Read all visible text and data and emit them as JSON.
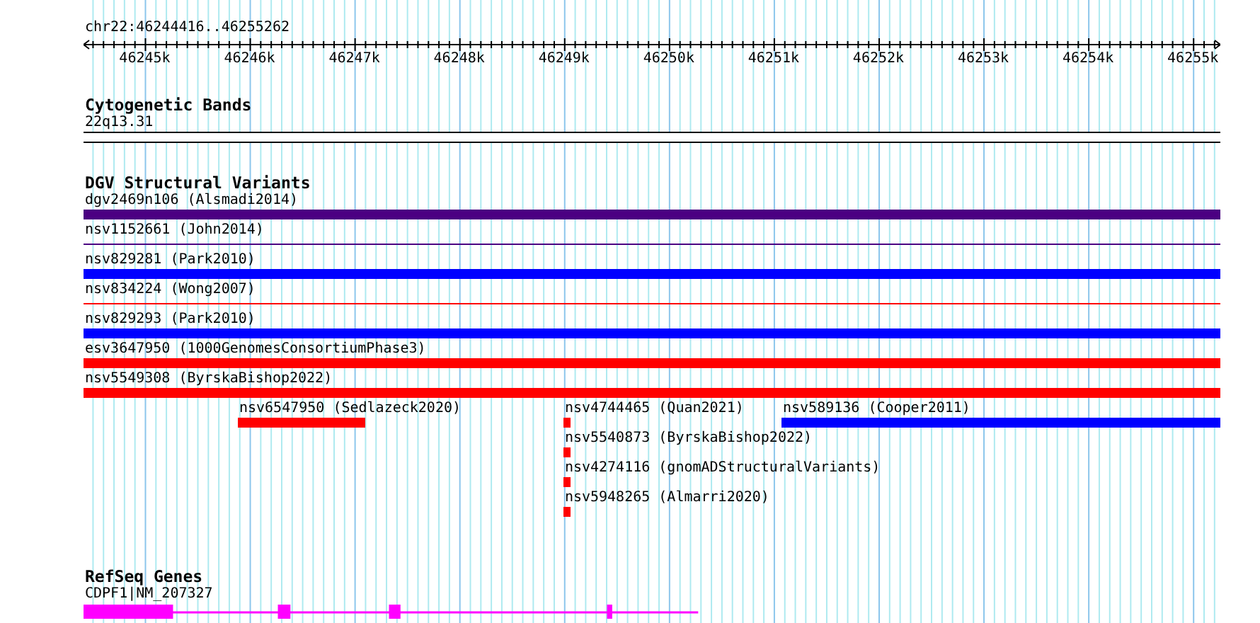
{
  "ruler": {
    "range_label": "chr22:46244416..46255262",
    "ticks": [
      {
        "label": "46245k"
      },
      {
        "label": "46246k"
      },
      {
        "label": "46247k"
      },
      {
        "label": "46248k"
      },
      {
        "label": "46249k"
      },
      {
        "label": "46250k"
      },
      {
        "label": "46251k"
      },
      {
        "label": "46252k"
      },
      {
        "label": "46253k"
      },
      {
        "label": "46254k"
      },
      {
        "label": "46255k"
      }
    ]
  },
  "tracks": [
    {
      "kind": "bands",
      "title": "Cytogenetic Bands",
      "bands": [
        {
          "label": "22q13.31"
        }
      ]
    },
    {
      "kind": "variants",
      "title": "DGV Structural Variants",
      "lanes": [
        {
          "features": [
            {
              "label": "dgv2469n106 (Alsmadi2014)",
              "kind": "bar",
              "color": "#4b0082"
            }
          ]
        },
        {
          "features": [
            {
              "label": "nsv1152661 (John2014)",
              "kind": "line",
              "color": "#4b0082"
            }
          ]
        },
        {
          "features": [
            {
              "label": "nsv829281 (Park2010)",
              "kind": "bar",
              "color": "#0000ff"
            }
          ]
        },
        {
          "features": [
            {
              "label": "nsv834224 (Wong2007)",
              "kind": "line",
              "color": "#ff0000"
            }
          ]
        },
        {
          "features": [
            {
              "label": "nsv829293 (Park2010)",
              "kind": "bar",
              "color": "#0000ff"
            }
          ]
        },
        {
          "features": [
            {
              "label": "esv3647950 (1000GenomesConsortiumPhase3)",
              "kind": "bar",
              "color": "#ff0000"
            }
          ]
        },
        {
          "features": [
            {
              "label": "nsv5549308 (ByrskaBishop2022)",
              "kind": "bar",
              "color": "#ff0000"
            }
          ]
        },
        {
          "features": [
            {
              "label": "nsv6547950 (Sedlazeck2020)",
              "kind": "bar",
              "color": "#ff0000"
            },
            {
              "label": "nsv4744465 (Quan2021)",
              "kind": "bar",
              "color": "#ff0000"
            },
            {
              "label": "nsv589136 (Cooper2011)",
              "kind": "bar",
              "color": "#0000ff"
            }
          ]
        },
        {
          "features": [
            {
              "label": "nsv5540873 (ByrskaBishop2022)",
              "kind": "bar",
              "color": "#ff0000"
            }
          ]
        },
        {
          "features": [
            {
              "label": "nsv4274116 (gnomADStructuralVariants)",
              "kind": "bar",
              "color": "#ff0000"
            }
          ]
        },
        {
          "features": [
            {
              "label": "nsv5948265 (Almarri2020)",
              "kind": "bar",
              "color": "#ff0000"
            }
          ]
        }
      ]
    },
    {
      "kind": "genes",
      "title": "RefSeq Genes",
      "genes": [
        {
          "label": "CDPF1|NM_207327"
        }
      ]
    }
  ]
}
